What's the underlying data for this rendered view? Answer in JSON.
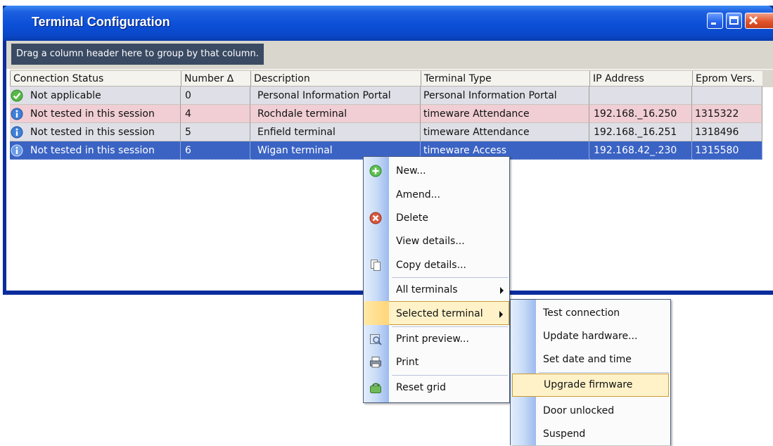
{
  "window": {
    "title": "Terminal Configuration"
  },
  "group_hint": "Drag a column header here to group by that column.",
  "columns": [
    {
      "label": "Connection Status"
    },
    {
      "label": "Number ∆"
    },
    {
      "label": "Description"
    },
    {
      "label": "Terminal Type"
    },
    {
      "label": "IP Address"
    },
    {
      "label": "Eprom Vers."
    }
  ],
  "rows": [
    {
      "status_icon": "check-icon",
      "status": "Not applicable",
      "number": "0",
      "description": "Personal Information Portal",
      "type": "Personal Information Portal",
      "ip": "",
      "eprom": ""
    },
    {
      "status_icon": "info-icon",
      "status": "Not tested in this session",
      "number": "4",
      "description": "Rochdale terminal",
      "type": "timeware Attendance",
      "ip": "192.168._16.250",
      "eprom": "1315322"
    },
    {
      "status_icon": "info-icon",
      "status": "Not tested in this session",
      "number": "5",
      "description": "Enfield terminal",
      "type": "timeware Attendance",
      "ip": "192.168._16.251",
      "eprom": "1318496"
    },
    {
      "status_icon": "info-icon",
      "status": "Not tested in this session",
      "number": "6",
      "description": "Wigan terminal",
      "type": "timeware Access",
      "ip": "192.168.42_.230",
      "eprom": "1315580"
    }
  ],
  "context_menu": {
    "items": [
      {
        "label": "New...",
        "icon": "add-icon"
      },
      {
        "label": "Amend...",
        "icon": ""
      },
      {
        "label": "Delete",
        "icon": "delete-icon"
      },
      {
        "label": "View details...",
        "icon": ""
      },
      {
        "label": "Copy details...",
        "icon": "copy-icon"
      },
      {
        "label": "All terminals",
        "icon": "",
        "submenu": true
      },
      {
        "label": "Selected terminal",
        "icon": "",
        "submenu": true,
        "active": true
      },
      {
        "label": "Print preview...",
        "icon": "print-preview-icon"
      },
      {
        "label": "Print",
        "icon": "printer-icon"
      },
      {
        "label": "Reset grid",
        "icon": "reset-grid-icon"
      }
    ]
  },
  "submenu": {
    "items": [
      {
        "label": "Test connection"
      },
      {
        "label": "Update hardware..."
      },
      {
        "label": "Set date and time"
      },
      {
        "label": "Upgrade firmware",
        "highlighted": true
      },
      {
        "label": "Door unlocked"
      },
      {
        "label": "Suspend"
      }
    ]
  },
  "colors": {
    "titlebar": "#0b4fd8",
    "selected_row": "#3b63c4",
    "pink_row": "#f0ced4",
    "gray_row": "#dfdfe7",
    "menu_highlight": "#fff2c8"
  }
}
